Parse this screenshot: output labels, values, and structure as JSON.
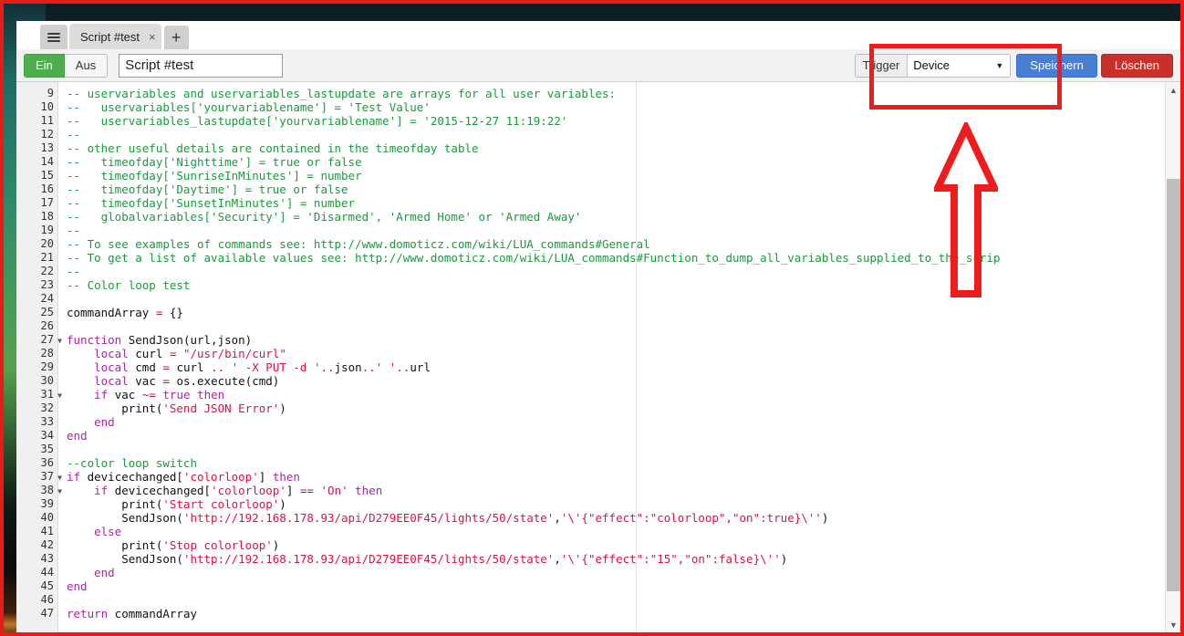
{
  "browser": {
    "menu_button_name": "hamburger-menu",
    "tab": {
      "title": "Script #test",
      "close_label": "×"
    },
    "new_tab_label": "+"
  },
  "toolbar": {
    "on_label": "Ein",
    "off_label": "Aus",
    "script_name_value": "Script #test",
    "script_name_placeholder": "Script #test",
    "trigger_label": "Trigger",
    "trigger_selected": "Device",
    "trigger_caret": "▼",
    "save_label": "Speichern",
    "delete_label": "Löschen"
  },
  "colors": {
    "accent_green": "#4cae4c",
    "primary_blue": "#4a7ed4",
    "danger_red": "#c9302c",
    "annotation_red": "#ee1c1c",
    "comment_green": "#1a9a3c",
    "string_red": "#d14",
    "keyword_purple": "#a626a4"
  },
  "editor": {
    "first_visible_line": 9,
    "last_visible_line": 47,
    "fold_lines": [
      27,
      31,
      37,
      38
    ],
    "line_numbers": [
      9,
      10,
      11,
      12,
      13,
      14,
      15,
      16,
      17,
      18,
      19,
      20,
      21,
      22,
      23,
      24,
      25,
      26,
      27,
      28,
      29,
      30,
      31,
      32,
      33,
      34,
      35,
      36,
      37,
      38,
      39,
      40,
      41,
      42,
      43,
      44,
      45,
      46,
      47
    ],
    "lines": [
      {
        "n": 9,
        "tokens": [
          {
            "t": "-- uservariables and uservariables_lastupdate are arrays for all user variables:",
            "c": "cm"
          }
        ]
      },
      {
        "n": 10,
        "tokens": [
          {
            "t": "--   uservariables['yourvariablename'] = 'Test Value'",
            "c": "cm"
          }
        ]
      },
      {
        "n": 11,
        "tokens": [
          {
            "t": "--   uservariables_lastupdate['yourvariablename'] = '2015-12-27 11:19:22'",
            "c": "cm"
          }
        ]
      },
      {
        "n": 12,
        "tokens": [
          {
            "t": "--",
            "c": "cm"
          }
        ]
      },
      {
        "n": 13,
        "tokens": [
          {
            "t": "-- other useful details are contained in the timeofday table",
            "c": "cm"
          }
        ]
      },
      {
        "n": 14,
        "tokens": [
          {
            "t": "--   timeofday['Nighttime'] = true or false",
            "c": "cm"
          }
        ]
      },
      {
        "n": 15,
        "tokens": [
          {
            "t": "--   timeofday['SunriseInMinutes'] = number",
            "c": "cm"
          }
        ]
      },
      {
        "n": 16,
        "tokens": [
          {
            "t": "--   timeofday['Daytime'] = true or false",
            "c": "cm"
          }
        ]
      },
      {
        "n": 17,
        "tokens": [
          {
            "t": "--   timeofday['SunsetInMinutes'] = number",
            "c": "cm"
          }
        ]
      },
      {
        "n": 18,
        "tokens": [
          {
            "t": "--   globalvariables['Security'] = 'Disarmed', 'Armed Home' or 'Armed Away'",
            "c": "cm"
          }
        ]
      },
      {
        "n": 19,
        "tokens": [
          {
            "t": "--",
            "c": "cm"
          }
        ]
      },
      {
        "n": 20,
        "tokens": [
          {
            "t": "-- To see examples of commands see: http://www.domoticz.com/wiki/LUA_commands#General",
            "c": "cm"
          }
        ]
      },
      {
        "n": 21,
        "tokens": [
          {
            "t": "-- To get a list of available values see: http://www.domoticz.com/wiki/LUA_commands#Function_to_dump_all_variables_supplied_to_the_scrip",
            "c": "cm"
          }
        ]
      },
      {
        "n": 22,
        "tokens": [
          {
            "t": "--",
            "c": "cm"
          }
        ]
      },
      {
        "n": 23,
        "tokens": [
          {
            "t": "-- Color loop test",
            "c": "cm"
          }
        ]
      },
      {
        "n": 24,
        "tokens": [
          {
            "t": "",
            "c": "pl"
          }
        ]
      },
      {
        "n": 25,
        "tokens": [
          {
            "t": "commandArray ",
            "c": "pl"
          },
          {
            "t": "=",
            "c": "op"
          },
          {
            "t": " {}",
            "c": "pl"
          }
        ]
      },
      {
        "n": 26,
        "tokens": [
          {
            "t": "",
            "c": "pl"
          }
        ]
      },
      {
        "n": 27,
        "tokens": [
          {
            "t": "function",
            "c": "kw"
          },
          {
            "t": " SendJson(url,json)",
            "c": "pl"
          }
        ]
      },
      {
        "n": 28,
        "tokens": [
          {
            "t": "    ",
            "c": "pl"
          },
          {
            "t": "local",
            "c": "kw"
          },
          {
            "t": " curl ",
            "c": "pl"
          },
          {
            "t": "=",
            "c": "op"
          },
          {
            "t": " ",
            "c": "pl"
          },
          {
            "t": "\"/usr/bin/curl\"",
            "c": "str"
          }
        ]
      },
      {
        "n": 29,
        "tokens": [
          {
            "t": "    ",
            "c": "pl"
          },
          {
            "t": "local",
            "c": "kw"
          },
          {
            "t": " cmd ",
            "c": "pl"
          },
          {
            "t": "=",
            "c": "op"
          },
          {
            "t": " curl ",
            "c": "pl"
          },
          {
            "t": "..",
            "c": "op"
          },
          {
            "t": " ",
            "c": "pl"
          },
          {
            "t": "' -X PUT -d '",
            "c": "str"
          },
          {
            "t": "..",
            "c": "op"
          },
          {
            "t": "json",
            "c": "pl"
          },
          {
            "t": "..",
            "c": "op"
          },
          {
            "t": "' '",
            "c": "str"
          },
          {
            "t": "..",
            "c": "op"
          },
          {
            "t": "url",
            "c": "pl"
          }
        ]
      },
      {
        "n": 30,
        "tokens": [
          {
            "t": "    ",
            "c": "pl"
          },
          {
            "t": "local",
            "c": "kw"
          },
          {
            "t": " vac ",
            "c": "pl"
          },
          {
            "t": "=",
            "c": "op"
          },
          {
            "t": " os.execute(cmd)",
            "c": "pl"
          }
        ]
      },
      {
        "n": 31,
        "tokens": [
          {
            "t": "    ",
            "c": "pl"
          },
          {
            "t": "if",
            "c": "kw"
          },
          {
            "t": " vac ",
            "c": "pl"
          },
          {
            "t": "~=",
            "c": "op"
          },
          {
            "t": " ",
            "c": "pl"
          },
          {
            "t": "true",
            "c": "kw"
          },
          {
            "t": " ",
            "c": "pl"
          },
          {
            "t": "then",
            "c": "kw"
          }
        ]
      },
      {
        "n": 32,
        "tokens": [
          {
            "t": "        print(",
            "c": "pl"
          },
          {
            "t": "'Send JSON Error'",
            "c": "str"
          },
          {
            "t": ")",
            "c": "pl"
          }
        ]
      },
      {
        "n": 33,
        "tokens": [
          {
            "t": "    ",
            "c": "pl"
          },
          {
            "t": "end",
            "c": "kw"
          }
        ]
      },
      {
        "n": 34,
        "tokens": [
          {
            "t": "end",
            "c": "kw"
          }
        ]
      },
      {
        "n": 35,
        "tokens": [
          {
            "t": "",
            "c": "pl"
          }
        ]
      },
      {
        "n": 36,
        "tokens": [
          {
            "t": "--color loop switch",
            "c": "cm"
          }
        ]
      },
      {
        "n": 37,
        "tokens": [
          {
            "t": "if",
            "c": "kw"
          },
          {
            "t": " devicechanged[",
            "c": "pl"
          },
          {
            "t": "'colorloop'",
            "c": "str"
          },
          {
            "t": "] ",
            "c": "pl"
          },
          {
            "t": "then",
            "c": "kw"
          }
        ]
      },
      {
        "n": 38,
        "tokens": [
          {
            "t": "    ",
            "c": "pl"
          },
          {
            "t": "if",
            "c": "kw"
          },
          {
            "t": " devicechanged[",
            "c": "pl"
          },
          {
            "t": "'colorloop'",
            "c": "str"
          },
          {
            "t": "] ",
            "c": "pl"
          },
          {
            "t": "==",
            "c": "op"
          },
          {
            "t": " ",
            "c": "pl"
          },
          {
            "t": "'On'",
            "c": "str"
          },
          {
            "t": " ",
            "c": "pl"
          },
          {
            "t": "then",
            "c": "kw"
          }
        ]
      },
      {
        "n": 39,
        "tokens": [
          {
            "t": "        print(",
            "c": "pl"
          },
          {
            "t": "'Start colorloop'",
            "c": "str"
          },
          {
            "t": ")",
            "c": "pl"
          }
        ]
      },
      {
        "n": 40,
        "tokens": [
          {
            "t": "        SendJson(",
            "c": "pl"
          },
          {
            "t": "'http://192.168.178.93/api/D279EE0F45/lights/50/state'",
            "c": "str"
          },
          {
            "t": ",",
            "c": "pl"
          },
          {
            "t": "'\\'{\"effect\":\"colorloop\",\"on\":true}\\''",
            "c": "str"
          },
          {
            "t": ")",
            "c": "pl"
          }
        ]
      },
      {
        "n": 41,
        "tokens": [
          {
            "t": "    ",
            "c": "pl"
          },
          {
            "t": "else",
            "c": "kw"
          }
        ]
      },
      {
        "n": 42,
        "tokens": [
          {
            "t": "        print(",
            "c": "pl"
          },
          {
            "t": "'Stop colorloop'",
            "c": "str"
          },
          {
            "t": ")",
            "c": "pl"
          }
        ]
      },
      {
        "n": 43,
        "tokens": [
          {
            "t": "        SendJson(",
            "c": "pl"
          },
          {
            "t": "'http://192.168.178.93/api/D279EE0F45/lights/50/state'",
            "c": "str"
          },
          {
            "t": ",",
            "c": "pl"
          },
          {
            "t": "'\\'{\"effect\":\"15\",\"on\":false}\\''",
            "c": "str"
          },
          {
            "t": ")",
            "c": "pl"
          }
        ]
      },
      {
        "n": 44,
        "tokens": [
          {
            "t": "    ",
            "c": "pl"
          },
          {
            "t": "end",
            "c": "kw"
          }
        ]
      },
      {
        "n": 45,
        "tokens": [
          {
            "t": "end",
            "c": "kw"
          }
        ]
      },
      {
        "n": 46,
        "tokens": [
          {
            "t": "",
            "c": "pl"
          }
        ]
      },
      {
        "n": 47,
        "tokens": [
          {
            "t": "return",
            "c": "kw"
          },
          {
            "t": " commandArray",
            "c": "pl"
          }
        ]
      }
    ]
  },
  "scrollbar": {
    "up_arrow": "▲",
    "down_arrow": "▼"
  },
  "annotations": {
    "box_name": "trigger-highlight-box",
    "arrow_name": "pointing-up-arrow",
    "color": "#ee1c1c"
  }
}
